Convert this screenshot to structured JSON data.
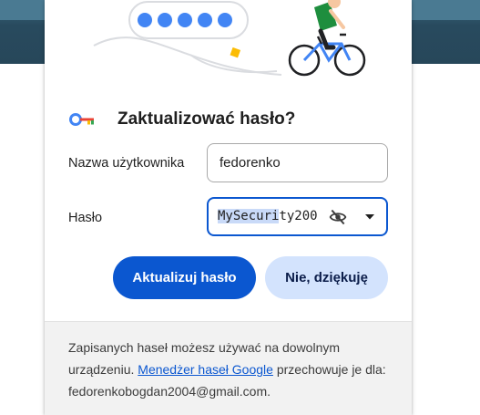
{
  "dialog": {
    "title": "Zaktualizować hasło?",
    "username_label": "Nazwa użytkownika",
    "username_value": "fedorenko",
    "password_label": "Hasło",
    "password_value_selected": "MySecuri",
    "password_value_rest": "ty200",
    "update_button": "Aktualizuj hasło",
    "decline_button": "Nie, dziękuję",
    "footer_before_link": "Zapisanych haseł możesz używać na dowolnym urządzeniu.",
    "footer_link": "Menedżer haseł Google",
    "footer_after_link": "przechowuje je dla: fedorenkobogdan2004@gmail.com."
  },
  "colors": {
    "accent": "#0b57d0",
    "secondary_button_bg": "#d3e3fd",
    "footer_bg": "#f2f2f2",
    "header_bg": "#284a5e",
    "illustration_green": "#1e8e3e",
    "illustration_yellow": "#fbbc04"
  },
  "icons": {
    "title_icon": "key-icon",
    "visibility_toggle": "eye-off-icon",
    "dropdown": "caret-down-icon"
  }
}
